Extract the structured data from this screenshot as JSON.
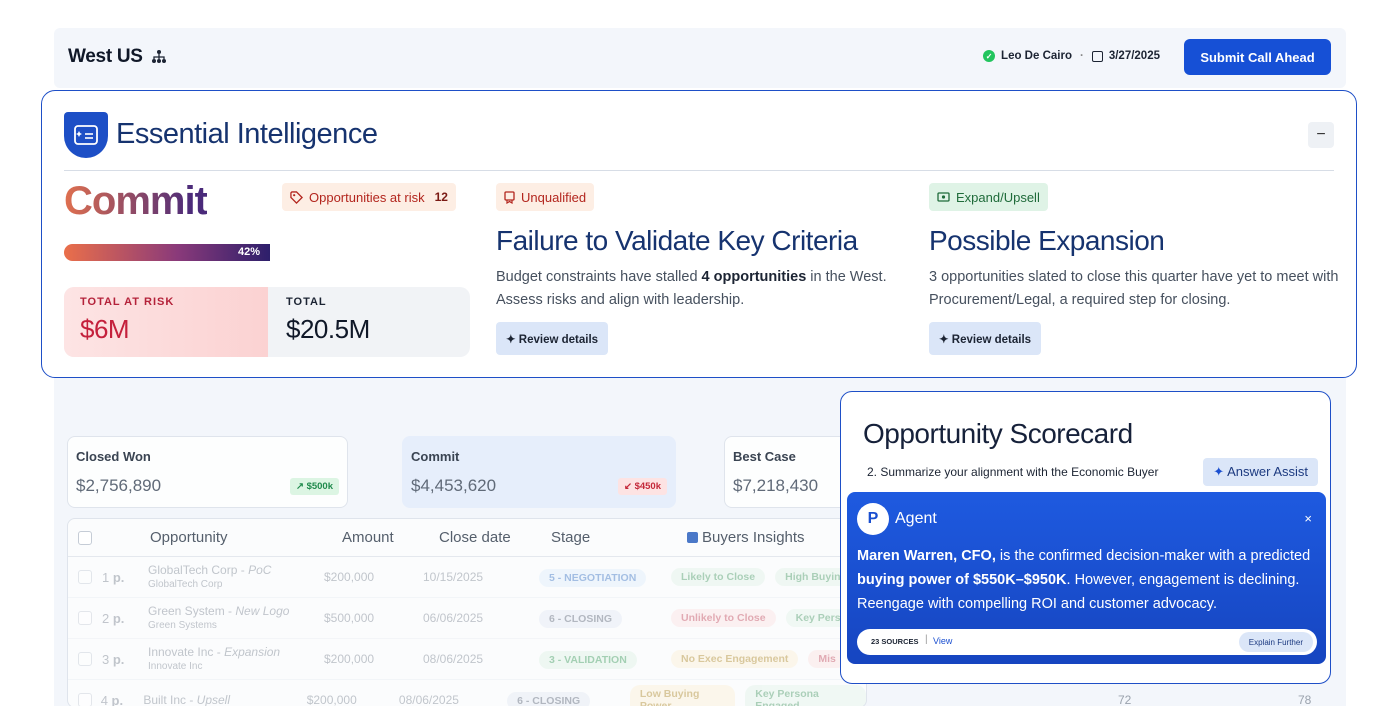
{
  "header": {
    "region": "West US",
    "user": "Leo De Cairo",
    "separator": "·",
    "date": "3/27/2025",
    "submit_label": "Submit Call Ahead"
  },
  "ei": {
    "title": "Essential Intelligence",
    "collapse": "−",
    "forecast": "Commit",
    "progress_label": "42%",
    "progress": 0.42,
    "risk_chip": {
      "label": "Opportunities at risk",
      "count": "12"
    },
    "totals": {
      "risk_label": "TOTAL AT RISK",
      "risk_value": "$6M",
      "total_label": "TOTAL",
      "total_value": "$20.5M"
    },
    "insights": [
      {
        "tag": "Unqualified",
        "title": "Failure to Validate Key Criteria",
        "body_pre": "Budget constraints have stalled ",
        "body_bold": "4 opportunities",
        "body_post": " in the West. Assess risks and align with leadership.",
        "button": "Review details"
      },
      {
        "tag": "Expand/Upsell",
        "title": "Possible Expansion",
        "body": "3 opportunities slated to close this quarter have yet to meet with Procurement/Legal, a required step for closing.",
        "button": "Review details"
      }
    ]
  },
  "kpis": [
    {
      "label": "Closed Won",
      "value": "$2,756,890",
      "delta": "↗ $500k"
    },
    {
      "label": "Commit",
      "value": "$4,453,620",
      "delta": "↙ $450k"
    },
    {
      "label": "Best Case",
      "value": "$7,218,430"
    }
  ],
  "table": {
    "headers": [
      "Opportunity",
      "Amount",
      "Close date",
      "Stage",
      "Buyers Insights"
    ],
    "rows": [
      {
        "num": "1",
        "p": "p.",
        "name": "GlobalTech Corp",
        "type": "PoC",
        "company": "GlobalTech Corp",
        "amount": "$200,000",
        "date": "10/15/2025",
        "stage": "5 - NEGOTIATION",
        "tag1": "Likely to Close",
        "tag2": "High Buyin"
      },
      {
        "num": "2",
        "p": "p.",
        "name": "Green System",
        "type": "New Logo",
        "company": "Green Systems",
        "amount": "$500,000",
        "date": "06/06/2025",
        "stage": "6 - CLOSING",
        "tag1": "Unlikely to Close",
        "tag2": "Key Pers"
      },
      {
        "num": "3",
        "p": "p.",
        "name": "Innovate Inc",
        "type": "Expansion",
        "company": "Innovate Inc",
        "amount": "$200,000",
        "date": "08/06/2025",
        "stage": "3 - VALIDATION",
        "tag1": "No Exec Engagement",
        "tag2": "Mis"
      },
      {
        "num": "4",
        "p": "p.",
        "name": "Built Inc",
        "type": "Upsell",
        "company": "",
        "amount": "$200,000",
        "date": "08/06/2025",
        "stage": "6 - CLOSING",
        "tag1": "Low Buying Power",
        "tag2": "Key Persona Engaged",
        "score1": "72",
        "score2": "78"
      }
    ]
  },
  "scorecard": {
    "title": "Opportunity Scorecard",
    "question": "2. Summarize your alignment with the Economic Buyer",
    "assist": "Answer Assist",
    "agent": {
      "logo": "P",
      "name": "Agent",
      "close": "×",
      "bold1": "Maren Warren, CFO,",
      "text1": " is the confirmed decision-maker with a predicted ",
      "bold2": "buying power of $550K–$950K",
      "text2": ". However, engagement is declining. Reengage with compelling ROI and customer advocacy.",
      "sources": "23 SOURCES",
      "view": "View",
      "explain": "Explain Further"
    }
  }
}
